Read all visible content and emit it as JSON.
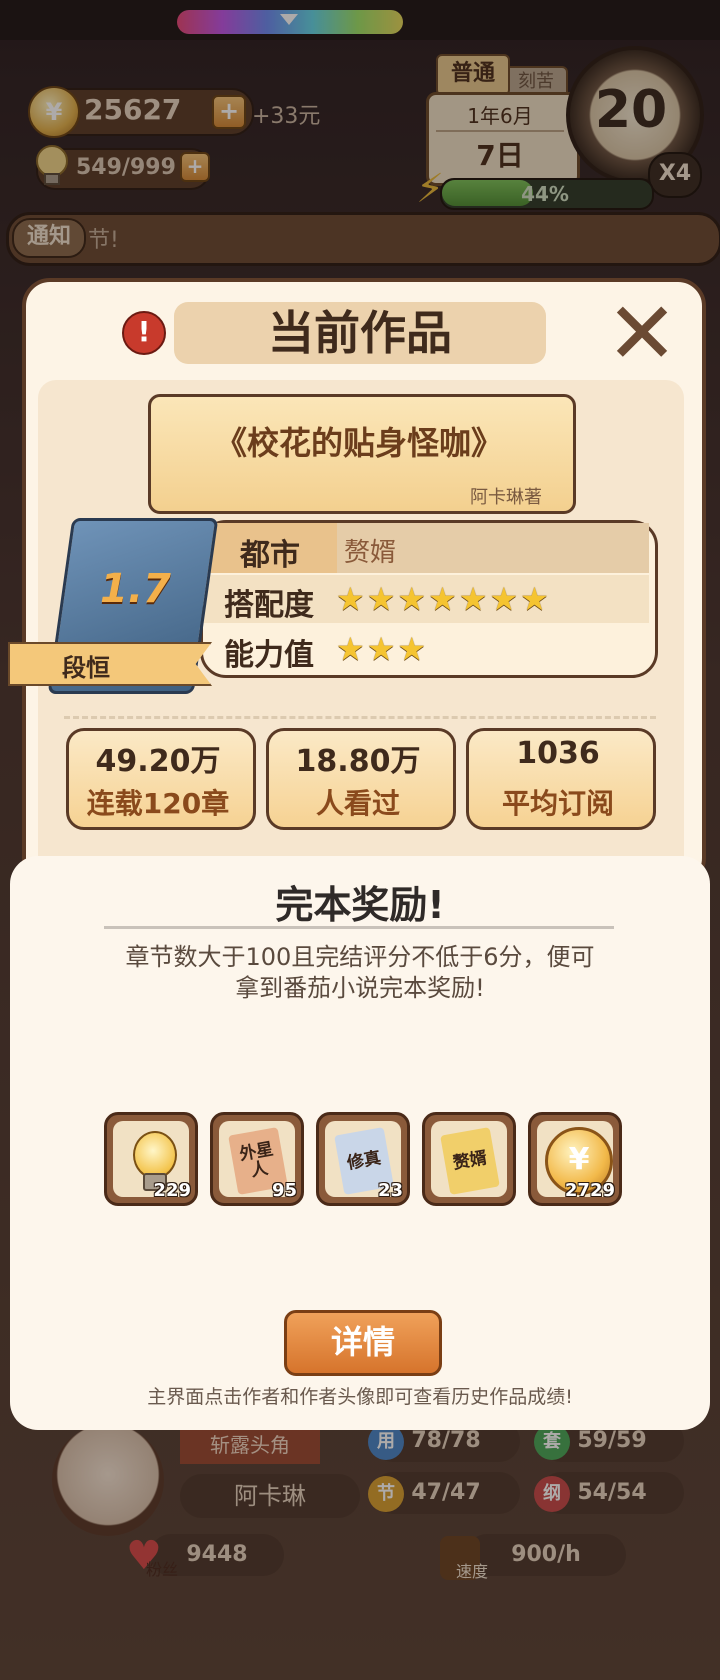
{
  "hud": {
    "coins": "25627",
    "coin_icon": "¥",
    "coin_bonus": "+33元",
    "plus": "+",
    "bulbs": "549/999",
    "mode": "普通",
    "mode2": "刻苦",
    "month": "1年6月",
    "day": "7日",
    "dial_value": "20",
    "speed": "X4",
    "energy": "44%",
    "energy_level": 0.44,
    "notice_tag": "通知",
    "notice_text": "节!"
  },
  "modal": {
    "alert": "!",
    "title": "当前作品",
    "close": "✕",
    "book_title": "《校花的贴身怪咖》",
    "author": "阿卡琳著",
    "score": "1.7",
    "ribbon": "段恒",
    "genre_label": "都市",
    "genre_value": "赘婿",
    "fit_label": "搭配度",
    "fit_stars": 7,
    "ability_label": "能力值",
    "ability_stars": 3,
    "stats": [
      {
        "value": "49.20万",
        "label": "连载120章"
      },
      {
        "value": "18.80万",
        "label": "人看过"
      },
      {
        "value": "1036",
        "label": "平均订阅"
      }
    ]
  },
  "reward": {
    "title": "完本奖励!",
    "desc_line1": "章节数大于100且完结评分不低于6分，便可",
    "desc_line2": "拿到番茄小说完本奖励!",
    "items": [
      {
        "type": "bulb",
        "count": "229"
      },
      {
        "type": "book",
        "label": "外星人",
        "count": "95",
        "color": "#e7b08a"
      },
      {
        "type": "book",
        "label": "修真",
        "count": "23",
        "color": "#c9d6e8"
      },
      {
        "type": "book",
        "label": "赘婿",
        "count": "",
        "color": "#f1cf6a"
      },
      {
        "type": "coin",
        "label": "¥",
        "count": "2729"
      }
    ],
    "detail_button": "详情",
    "hint": "主界面点击作者和作者头像即可查看历史作品成绩!"
  },
  "under": {
    "title_tag": "斩露头角",
    "author": "阿卡琳",
    "stats": [
      {
        "icon": "用",
        "value": "78/78",
        "color": "#4a86c8"
      },
      {
        "icon": "套",
        "value": "59/59",
        "color": "#4aa85a"
      },
      {
        "icon": "节",
        "value": "47/47",
        "color": "#d8a032"
      },
      {
        "icon": "纲",
        "value": "54/54",
        "color": "#c84a4a"
      }
    ],
    "fans_label": "粉丝",
    "fans": "9448",
    "speed_label": "速度",
    "speed": "900/h"
  }
}
